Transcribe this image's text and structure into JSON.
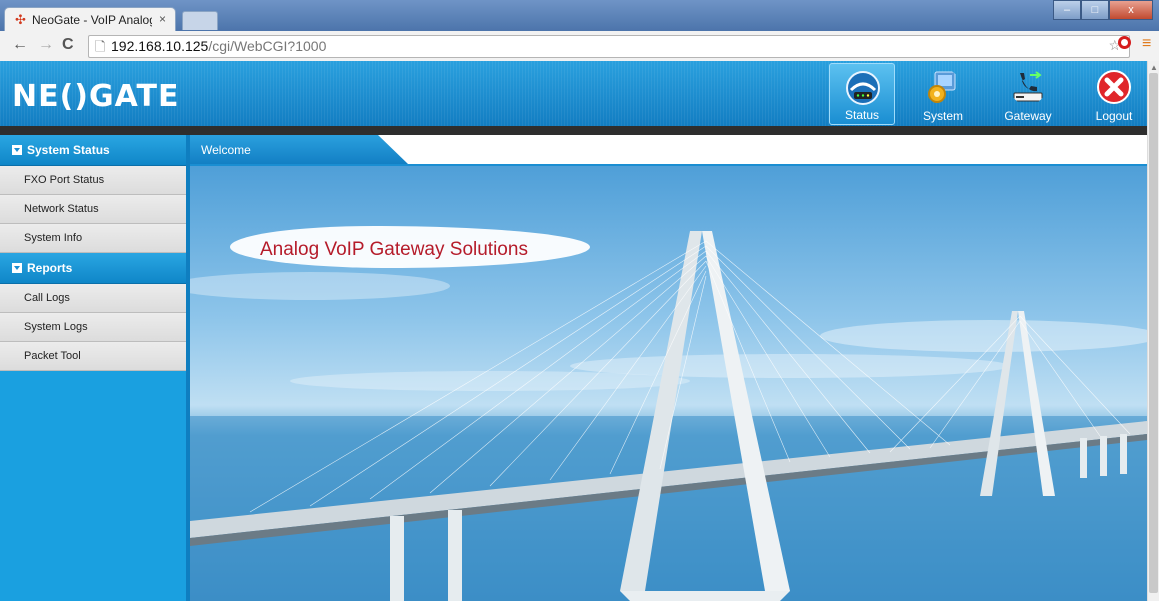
{
  "browser": {
    "tab_title": "NeoGate - VoIP Analog",
    "tab_close": "×",
    "url_host": "192.168.10.125",
    "url_path": "/cgi/WebCGI?1000",
    "window_buttons": [
      "–",
      "□",
      "x"
    ],
    "nav": {
      "back": "←",
      "forward": "→",
      "reload": "C"
    }
  },
  "app": {
    "logo": "NE()GATE",
    "nav": [
      {
        "label": "Status",
        "icon": "status-icon",
        "active": true
      },
      {
        "label": "System",
        "icon": "system-gear-icon",
        "active": false
      },
      {
        "label": "Gateway",
        "icon": "gateway-phone-icon",
        "active": false
      },
      {
        "label": "Logout",
        "icon": "logout-x-icon",
        "active": false
      }
    ]
  },
  "sidebar": {
    "sections": [
      {
        "title": "System Status",
        "items": [
          "FXO Port Status",
          "Network Status",
          "System Info"
        ]
      },
      {
        "title": "Reports",
        "items": [
          "Call Logs",
          "System Logs",
          "Packet Tool"
        ]
      }
    ]
  },
  "main": {
    "tab_label": "Welcome",
    "banner_text": "Analog VoIP Gateway Solutions"
  },
  "colors": {
    "brand_blue": "#1a8ed2",
    "banner_text": "#b51b2a",
    "logout_red": "#e0262a"
  }
}
